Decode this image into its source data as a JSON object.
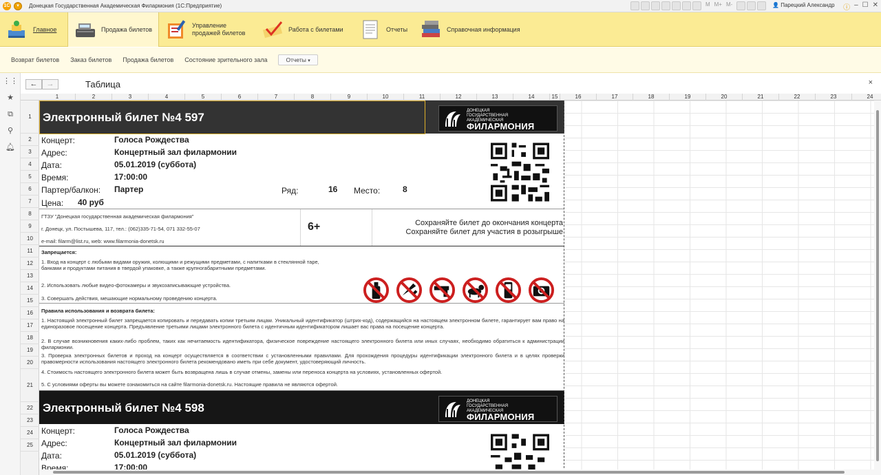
{
  "window": {
    "title": "Донецкая Государственная Академическая Филармония  (1С:Предприятие)",
    "user": "Парецкий Александр",
    "zoom_marks": [
      "M",
      "M+",
      "M-"
    ]
  },
  "sections": [
    {
      "label": "Главное",
      "icon": "home-icon"
    },
    {
      "label": "Продажа билетов",
      "icon": "cash-register-icon"
    },
    {
      "label": "Управление продажей билетов",
      "icon": "clipboard-pen-icon"
    },
    {
      "label": "Работа с билетами",
      "icon": "ticket-check-icon"
    },
    {
      "label": "Отчеты",
      "icon": "report-icon"
    },
    {
      "label": "Справочная информация",
      "icon": "books-icon"
    }
  ],
  "nav": {
    "links": [
      "Возврат билетов",
      "Заказ билетов",
      "Продажа билетов",
      "Состояние зрительного зала"
    ],
    "reports_dropdown": "Отчеты"
  },
  "form": {
    "title": "Таблица",
    "back": "←",
    "forward": "→",
    "close": "×"
  },
  "columns": [
    "1",
    "2",
    "3",
    "4",
    "5",
    "6",
    "7",
    "8",
    "9",
    "10",
    "11",
    "12",
    "13",
    "14",
    "15",
    "16",
    "17",
    "18",
    "19",
    "20",
    "21",
    "22",
    "23",
    "24"
  ],
  "rows": [
    "1",
    "2",
    "3",
    "4",
    "5",
    "6",
    "7",
    "8",
    "9",
    "10",
    "11",
    "12",
    "13",
    "14",
    "15",
    "16",
    "17",
    "18",
    "19",
    "20",
    "21",
    "22",
    "23",
    "24",
    "25"
  ],
  "ticket1": {
    "title": "Электронный билет №4 597",
    "concert_label": "Концерт:",
    "concert": "Голоса Рождества",
    "address_label": "Адрес:",
    "address": "Концертный зал филармонии",
    "date_label": "Дата:",
    "date": "05.01.2019 (суббота)",
    "time_label": "Время:",
    "time": "17:00:00",
    "section_label": "Партер/балкон:",
    "section": "Партер",
    "row_label": "Ряд:",
    "row": "16",
    "seat_label": "Место:",
    "seat": "8",
    "price_label": "Цена:",
    "price": "40 руб",
    "org": "ГТЗУ \"Донецкая государственная академическая филармония\"",
    "org_address": "г. Донецк, ул. Постышева, 117, тел.: (062)335-71-54, 071 332-55-07",
    "org_contacts": "e-mail: filarm@list.ru, web: www.filarmonia-donetsk.ru",
    "age": "6+",
    "keep1": "Сохраняйте билет до окончания концерта",
    "keep2": "Сохраняйте билет для участия в розыгрыше",
    "forbidden_title": "Запрещается:",
    "forbidden1": "1. Вход на концерт с любыми видами оружия, колющими и режущими предметами, с напитками в стеклянной таре, банками и продуктами питания в твердой упаковке, а также крупногабаритными предметами.",
    "forbidden2": "2. Использовать любые видео-фотокамеры и звукозаписывающие устройства.",
    "forbidden3": "3. Совершать действия, мешающие нормальному проведению концерта.",
    "rules_title": "Правила использования и возврата билета:",
    "rule1": "1. Настоящий электронный билет запрещается копировать и передавать копии третьим лицам. Уникальный идентификатор (штрих-код), содержащийся на настоящем электронном билете, гарантирует вам право на единоразовое посещение концерта. Предъявление третьими лицами электронного билета с идентичным идентификатором лишает вас права на посещение концерта.",
    "rule2": "2. В случае возникновения каких-либо проблем, таких как нечитаемость идентификатора, физическое повреждение настоящего электронного билета или иных случаях, необходимо обратиться к администрации филармонии.",
    "rule3": "3. Проверка электронных билетов и проход на концерт осуществляется в соответствии с установленными правилами. Для прохождения процедуры идентификации электронного билета и в целях проверки правомерности использования настоящего электронного билета рекомендовано иметь при себе документ, удостоверяющий личность.",
    "rule4": "4. Стоимость настоящего электронного билета может быть возвращена лишь в случае отмены, замены или переноса концерта на условиях, установленных офертой.",
    "rule5": "5. С условиями оферты вы можете ознакомиться на сайте filarmonia-donetsk.ru. Настоящие правила не являются офертой."
  },
  "ticket2": {
    "title": "Электронный билет №4 598",
    "concert_label": "Концерт:",
    "concert": "Голоса Рождества",
    "address_label": "Адрес:",
    "address": "Концертный зал филармонии",
    "date_label": "Дата:",
    "date": "05.01.2019 (суббота)",
    "time_label": "Время:",
    "time": "17:00:00"
  },
  "logo": {
    "line1": "ДОНЕЦКАЯ",
    "line2": "ГОСУДАРСТВЕННАЯ",
    "line3": "АКАДЕМИЧЕСКАЯ",
    "name": "ФИЛАРМОНИЯ"
  },
  "forbidden_icons": [
    "no-bottle-icon",
    "no-knife-icon",
    "no-gun-icon",
    "no-pets-icon",
    "no-phone-icon",
    "no-camera-icon"
  ],
  "colors": {
    "section_bar": "#fbeb94",
    "ticket_header": "#161616",
    "forbidden_red": "#cc1f1f"
  }
}
